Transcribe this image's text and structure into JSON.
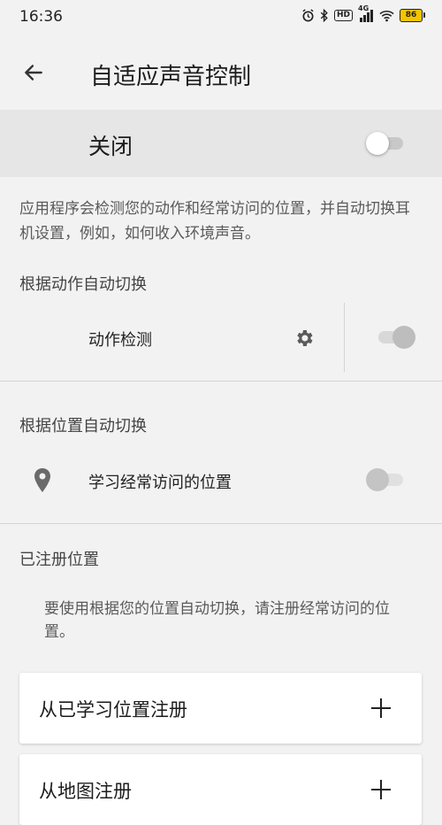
{
  "status_bar": {
    "time": "16:36",
    "network": "4G",
    "hd": "HD",
    "battery": "86"
  },
  "app_bar": {
    "title": "自适应声音控制"
  },
  "master": {
    "label": "关闭",
    "state": "off"
  },
  "description": "应用程序会检测您的动作和经常访问的位置，并自动切换耳机设置，例如，如何收入环境声音。",
  "motion_section": {
    "header": "根据动作自动切换",
    "item_label": "动作检测",
    "state": "on-disabled"
  },
  "location_section": {
    "header": "根据位置自动切换",
    "item_label": "学习经常访问的位置",
    "state": "off-disabled"
  },
  "registered_section": {
    "header": "已注册位置",
    "note": "要使用根据您的位置自动切换，请注册经常访问的位置。",
    "cards": [
      {
        "label": "从已学习位置注册"
      },
      {
        "label": "从地图注册"
      }
    ]
  }
}
